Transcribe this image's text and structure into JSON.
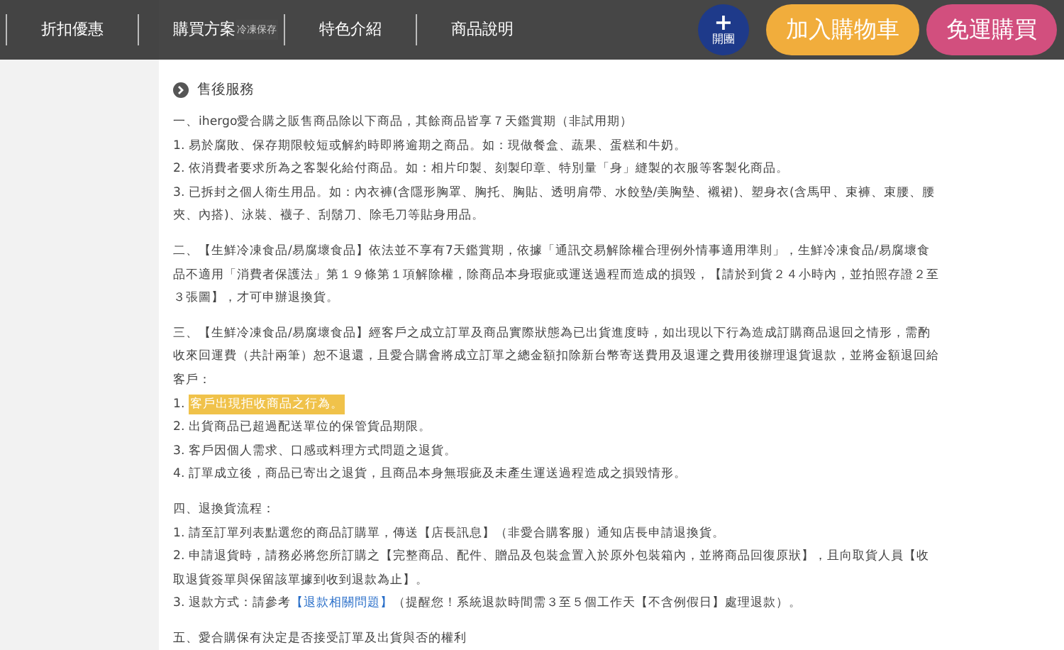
{
  "table_peek": [
    "冷凍保存"
  ],
  "nav": {
    "tabs": [
      "折扣優惠",
      "購買方案",
      "特色介紹",
      "商品說明"
    ]
  },
  "group_button": {
    "symbol": "+",
    "label": "開團"
  },
  "cart_button": "加入購物車",
  "buy_button": "免運購買",
  "section_title": "售後服務",
  "paragraphs": [
    {
      "lines": [
        {
          "kind": "plain",
          "text": "一、ihergo愛合購之販售商品除以下商品，其餘商品皆享７天鑑賞期（非試用期）"
        },
        {
          "kind": "plain",
          "text": "1. 易於腐敗、保存期限較短或解約時即將逾期之商品。如：現做餐盒、蔬果、蛋糕和牛奶。"
        },
        {
          "kind": "plain",
          "text": "2. 依消費者要求所為之客製化給付商品。如：相片印製、刻製印章、特別量「身」縫製的衣服等客製化商品。"
        },
        {
          "kind": "plain",
          "text": "3. 已拆封之個人衛生用品。如：內衣褲(含隱形胸罩、胸托、胸貼、透明肩帶、水餃墊/美胸墊、襯裙)、塑身衣(含馬甲、束褲、束腰、腰夾、內搭)、泳裝、襪子、刮鬍刀、除毛刀等貼身用品。"
        }
      ]
    },
    {
      "lines": [
        {
          "kind": "plain",
          "text": "二、【生鮮冷凍食品/易腐壞食品】依法並不享有7天鑑賞期，依據「通訊交易解除權合理例外情事適用準則」，生鮮冷凍食品/易腐壞食品不適用「消費者保護法」第１９條第１項解除權，除商品本身瑕疵或運送過程而造成的損毀，【請於到貨２４小時內，並拍照存證２至３張圖】，才可申辦退換貨。"
        }
      ]
    },
    {
      "lines": [
        {
          "kind": "plain",
          "text": "三、【生鮮冷凍食品/易腐壞食品】經客戶之成立訂單及商品實際狀態為已出貨進度時，如出現以下行為造成訂購商品退回之情形，需酌收來回運費（共計兩筆）恕不退還，且愛合購會將成立訂單之總金額扣除新台幣寄送費用及退運之費用後辦理退貨退款，並將金額退回給客戶："
        },
        {
          "kind": "highlight",
          "prefix": "1.",
          "text": "客戶出現拒收商品之行為。"
        },
        {
          "kind": "plain",
          "text": "2. 出貨商品已超過配送單位的保管貨品期限。"
        },
        {
          "kind": "plain",
          "text": "3. 客戶因個人需求、口感或料理方式問題之退貨。"
        },
        {
          "kind": "plain",
          "text": "4. 訂單成立後，商品已寄出之退貨，且商品本身無瑕疵及未產生運送過程造成之損毀情形。"
        }
      ]
    },
    {
      "lines": [
        {
          "kind": "plain",
          "text": "四、退換貨流程："
        },
        {
          "kind": "plain",
          "text": "1. 請至訂單列表點選您的商品訂購單，傳送【店長訊息】（非愛合購客服）通知店長申請退換貨。"
        },
        {
          "kind": "plain",
          "text": "2. 申請退貨時，請務必將您所訂購之【完整商品、配件、贈品及包裝盒置入於原外包裝箱內，並將商品回復原狀】，且向取貨人員【收取退貨簽單與保留該單據到收到退款為止】。"
        },
        {
          "kind": "link",
          "before": "3. 退款方式：請參考",
          "link": "【退款相關問題】",
          "after": "（提醒您！系統退款時間需３至５個工作天【不含例假日】處理退款）。"
        }
      ]
    },
    {
      "lines": [
        {
          "kind": "plain",
          "text": "五、愛合購保有決定是否接受訂單及出貨與否的權利"
        }
      ]
    }
  ]
}
